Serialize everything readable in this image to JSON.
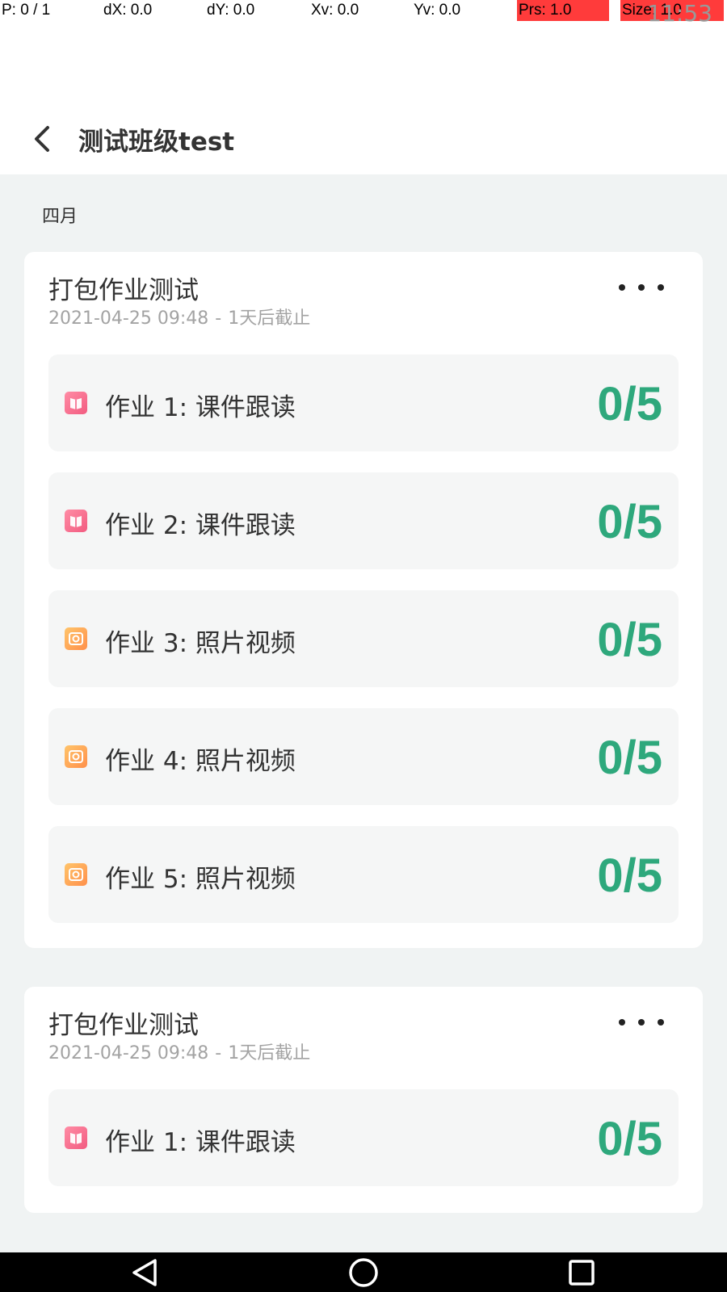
{
  "debug": {
    "p": "P: 0 / 1",
    "dx": "dX: 0.0",
    "dy": "dY: 0.0",
    "xv": "Xv: 0.0",
    "yv": "Yv: 0.0",
    "prs": "Prs: 1.0",
    "size": "Size: 1.0",
    "clock": "11:53"
  },
  "header": {
    "title": "测试班级test"
  },
  "month": "四月",
  "cards": [
    {
      "title": "打包作业测试",
      "datetime": "2021-04-25 09:48",
      "separator": "-",
      "deadline": "1天后截止",
      "items": [
        {
          "label": "作业 1: 课件跟读",
          "count": "0/5",
          "icon": "book-icon"
        },
        {
          "label": "作业 2: 课件跟读",
          "count": "0/5",
          "icon": "book-icon"
        },
        {
          "label": "作业 3: 照片视频",
          "count": "0/5",
          "icon": "camera-icon"
        },
        {
          "label": "作业 4: 照片视频",
          "count": "0/5",
          "icon": "camera-icon"
        },
        {
          "label": "作业 5: 照片视频",
          "count": "0/5",
          "icon": "camera-icon"
        }
      ]
    },
    {
      "title": "打包作业测试",
      "datetime": "2021-04-25 09:48",
      "separator": "-",
      "deadline": "1天后截止",
      "items": [
        {
          "label": "作业 1: 课件跟读",
          "count": "0/5",
          "icon": "book-icon"
        }
      ]
    }
  ],
  "colors": {
    "accent": "#2ea87c",
    "background": "#f0f3f3",
    "book_icon": "#f25b80",
    "camera_icon": "#ff8f4a"
  }
}
